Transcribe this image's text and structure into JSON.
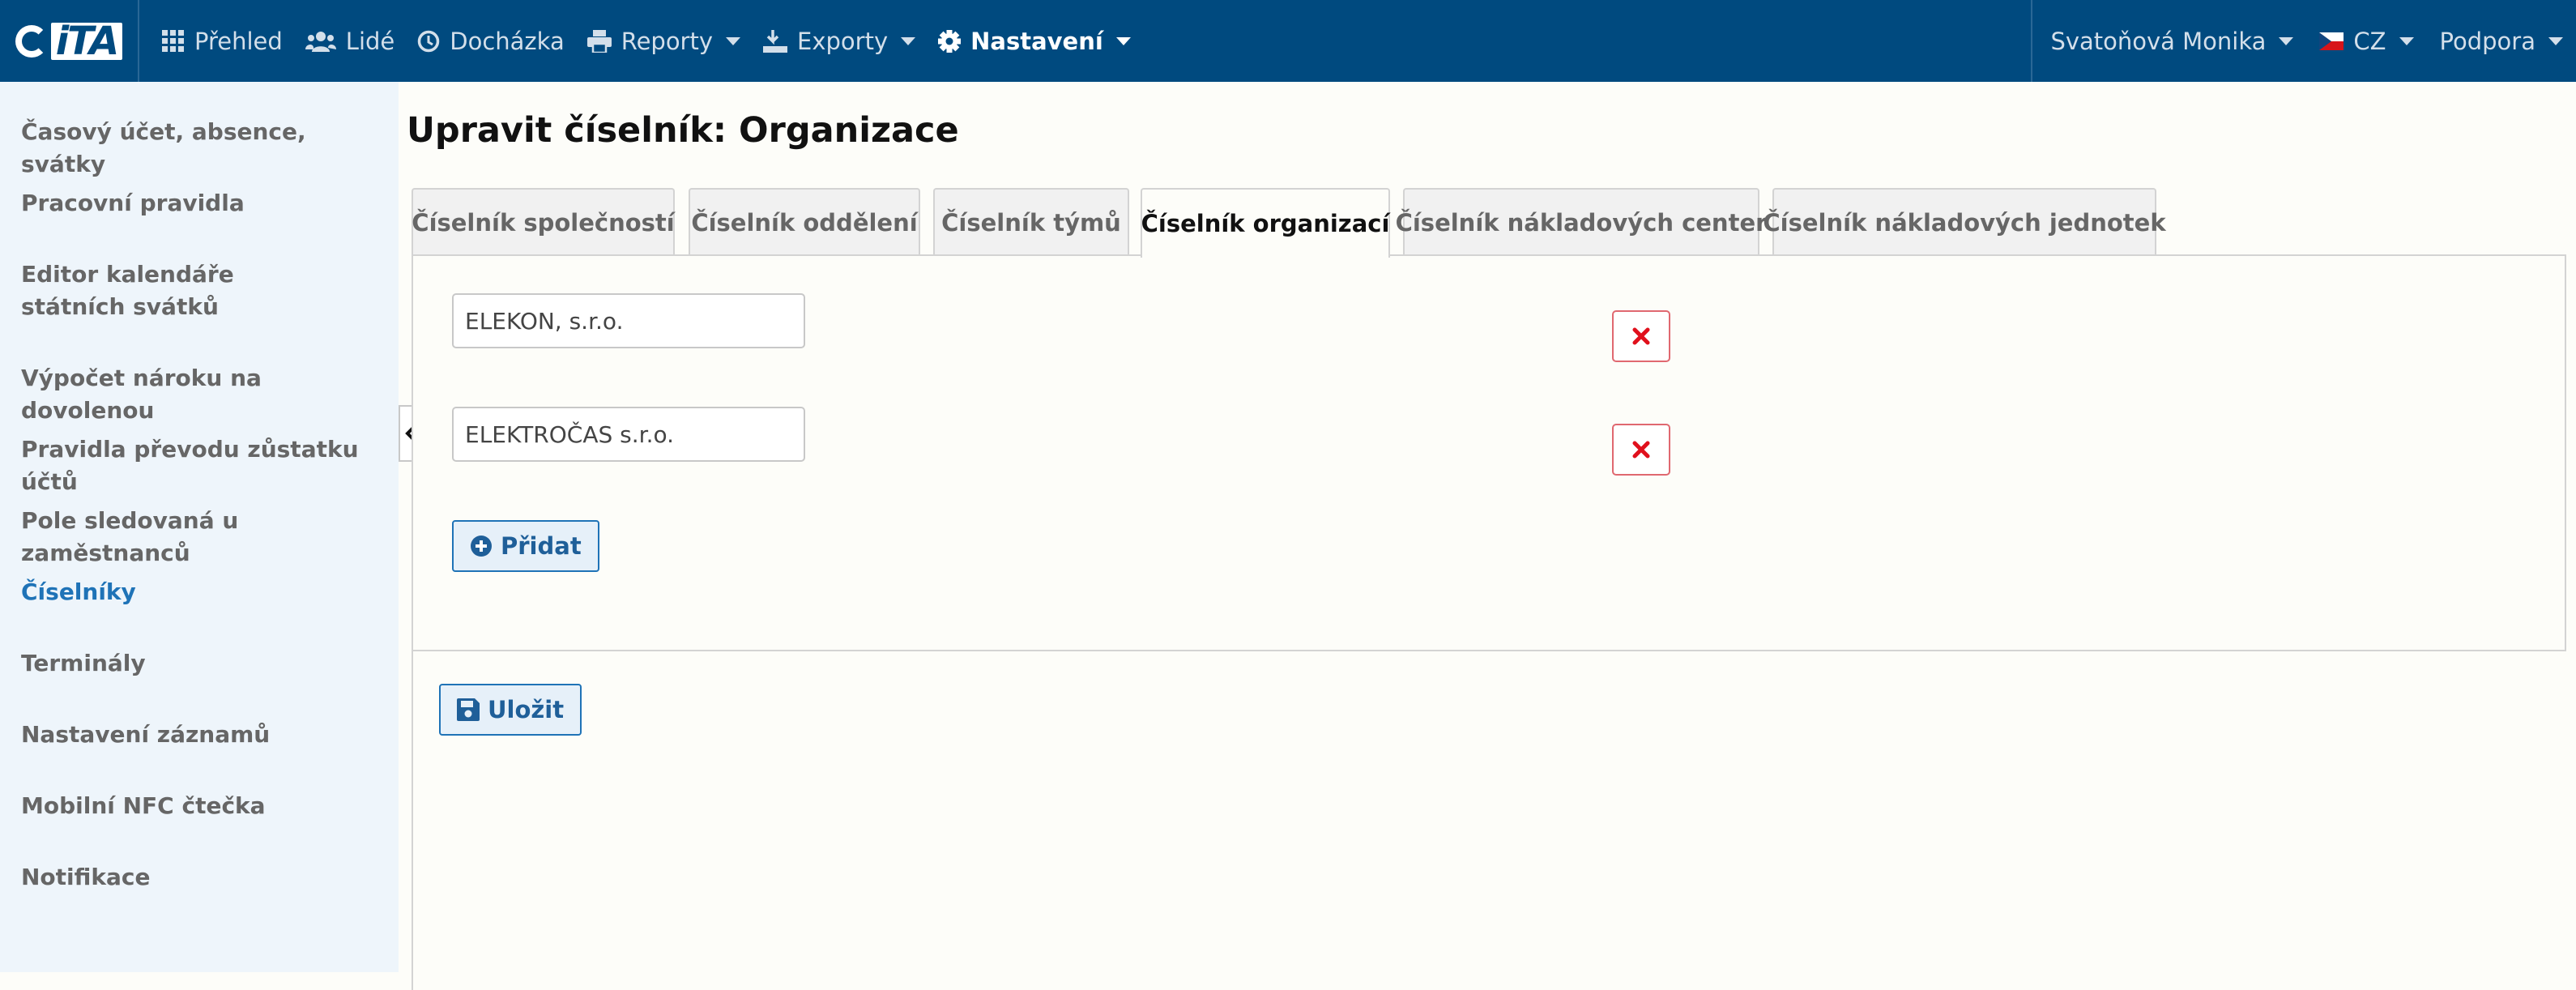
{
  "app": {
    "logo_text": "iTA"
  },
  "navbar": {
    "items": [
      {
        "label": "Přehled",
        "icon": "grid-icon"
      },
      {
        "label": "Lidé",
        "icon": "users-icon"
      },
      {
        "label": "Docházka",
        "icon": "clock-icon"
      },
      {
        "label": "Reporty",
        "icon": "print-icon"
      },
      {
        "label": "Exporty",
        "icon": "export-icon"
      },
      {
        "label": "Nastavení",
        "icon": "gear-icon"
      }
    ],
    "active": "Nastavení",
    "user": "Svatoňová Monika",
    "language": "CZ",
    "support": "Podpora"
  },
  "sidebar": {
    "items": [
      "Časový účet, absence, svátky",
      "Pracovní pravidla",
      "Editor kalendáře státních svátků",
      "Výpočet nároku na dovolenou",
      "Pravidla převodu zůstatku účtů",
      "Pole sledovaná u zaměstnanců",
      "Číselníky",
      "Terminály",
      "Nastavení záznamů",
      "Mobilní NFC čtečka",
      "Notifikace"
    ],
    "active": "Číselníky"
  },
  "page": {
    "title": "Upravit číselník: Organizace"
  },
  "tabs": [
    "Číselník společností",
    "Číselník oddělení",
    "Číselník týmů",
    "Číselník organizací",
    "Číselník nákladových center",
    "Číselník nákladových jednotek"
  ],
  "active_tab": "Číselník organizací",
  "entries": [
    {
      "value": "ELEKON, s.r.o."
    },
    {
      "value": "ELEKTROČAS s.r.o."
    }
  ],
  "buttons": {
    "add": "Přidat",
    "save": "Uložit"
  },
  "colors": {
    "navbar": "#004a7f",
    "sidebar": "#eef5fb",
    "accent": "#1f73b7",
    "delete": "#e0101c"
  }
}
